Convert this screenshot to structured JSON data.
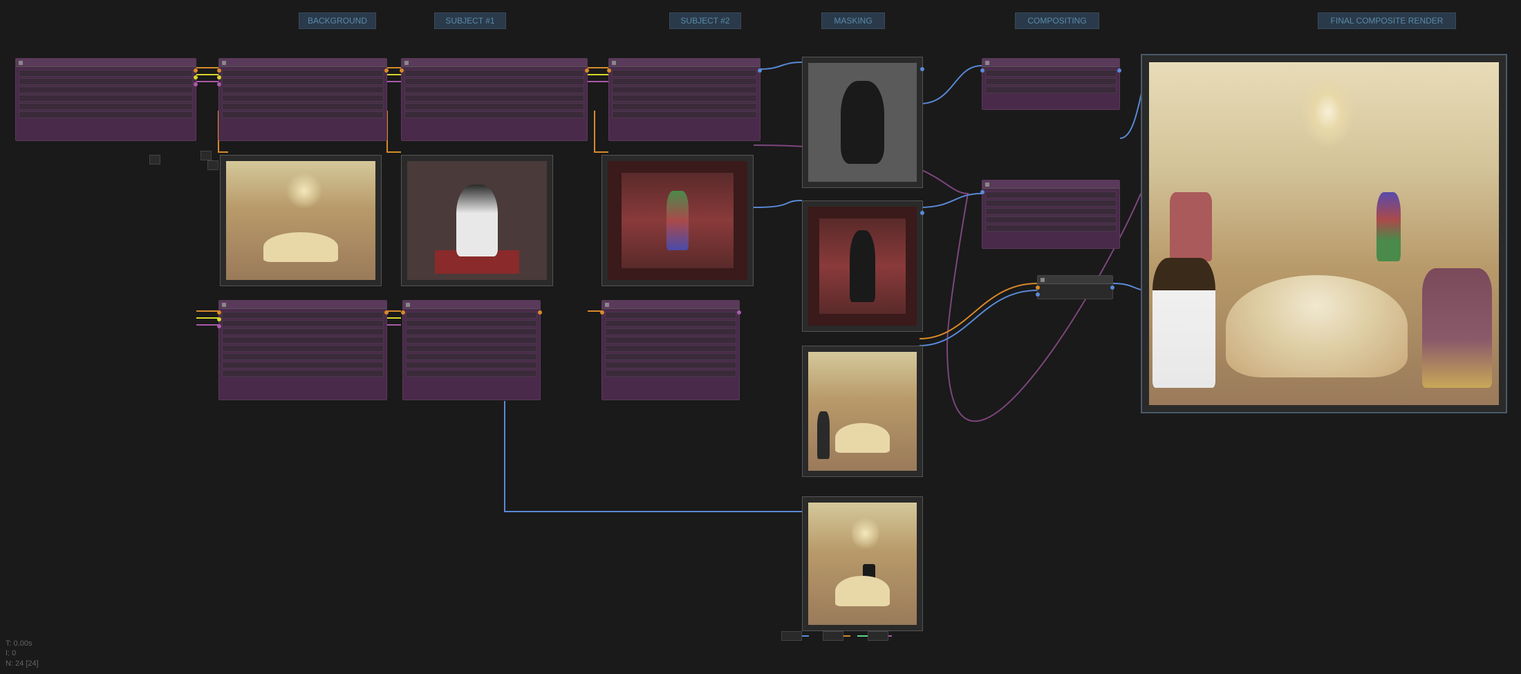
{
  "sections": {
    "background": "BACKGROUND",
    "subject1": "SUBJECT #1",
    "subject2": "SUBJECT #2",
    "masking": "MASKING",
    "compositing": "COMPOSITING",
    "final": "FINAL COMPOSITE RENDER"
  },
  "stats": {
    "time": "T: 0.00s",
    "iterations": "I: 0",
    "nodes": "N: 24 [24]"
  },
  "colors": {
    "wire_orange": "#d88a2a",
    "wire_purple": "#aa5aaa",
    "wire_yellow": "#d8d82a",
    "wire_blue": "#5a8ad8",
    "wire_green": "#5ad88a",
    "wire_red": "#d85a5a",
    "node_purple": "#4a2a4a",
    "node_dark": "#2a2a2a",
    "section_label_bg": "#2a3a4a",
    "section_label_text": "#5a8aaa"
  },
  "previews": {
    "background": "ballroom-interior",
    "queen": "queen-on-throne",
    "jester": "jester-on-stage",
    "mask_queen": "queen-silhouette-mask",
    "mask_jester": "jester-silhouette-mask",
    "composite_queen": "ballroom-with-queen-placed",
    "composite_jester": "ballroom-with-jester-placed",
    "final": "ballroom-queen-jester-feast-composite"
  },
  "node_types": {
    "prompt": "text-prompt-node",
    "sampler": "sampler-settings-node",
    "model": "model-loader-node",
    "mask": "mask-processor-node",
    "composite": "image-composite-node",
    "preview": "image-preview-node",
    "output": "final-output-node"
  }
}
